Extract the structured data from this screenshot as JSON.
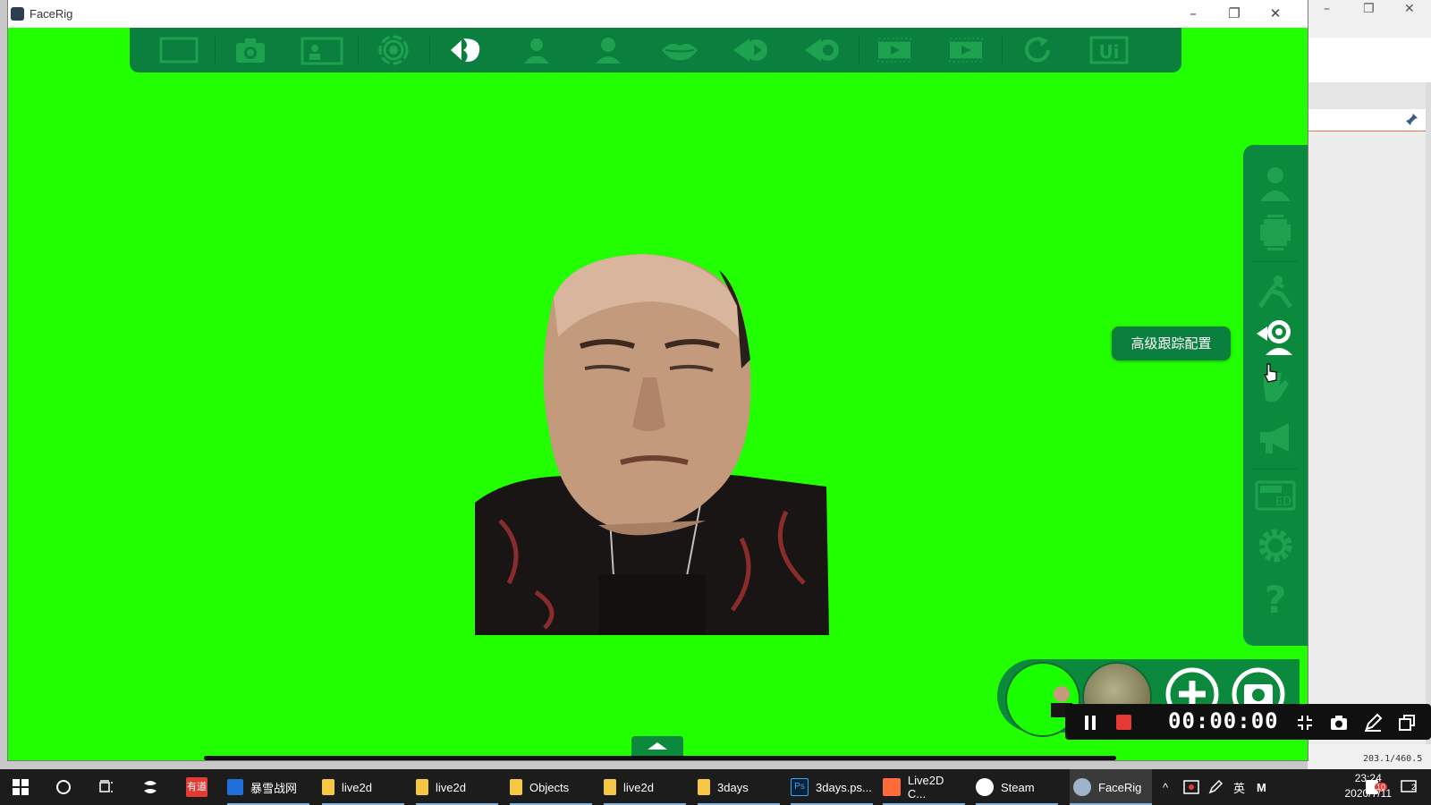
{
  "window": {
    "title": "FaceRig",
    "controls": {
      "minimize": "–",
      "restore": "❐",
      "close": "✕"
    }
  },
  "toolbar": {
    "items": [
      "fullscreen-icon",
      "camera-icon",
      "portrait-icon",
      "broadcast-icon",
      "face-tracking-icon",
      "avatar-icon",
      "avatar-alt-icon",
      "lips-icon",
      "play-icon",
      "eye-icon",
      "film-icon",
      "filmstrip-icon",
      "refresh-icon",
      "ui-icon"
    ],
    "ui_label": "Ui"
  },
  "side_panel": {
    "items": [
      "user-icon",
      "sizer-icon",
      "pose-icon",
      "advanced-tracking-icon",
      "hand-icon",
      "megaphone-icon",
      "ed-icon",
      "gear-icon",
      "help-icon"
    ],
    "ed_label": "ED",
    "help_label": "?"
  },
  "tooltip": {
    "text": "高级跟踪配置"
  },
  "recording": {
    "timer": "00:00:00"
  },
  "background_app": {
    "status": "203.1/460.5"
  },
  "taskbar": {
    "items": [
      {
        "label": "",
        "icon": "windows-icon"
      },
      {
        "label": "",
        "icon": "search-icon"
      },
      {
        "label": "",
        "icon": "task-view-icon"
      },
      {
        "label": "",
        "icon": "app-icon"
      },
      {
        "label": "有道",
        "icon": "youdao-icon"
      },
      {
        "label": "暴雪战网",
        "icon": "battlenet-icon"
      },
      {
        "label": "live2d",
        "icon": "folder-icon"
      },
      {
        "label": "live2d",
        "icon": "folder-icon"
      },
      {
        "label": "Objects",
        "icon": "folder-icon"
      },
      {
        "label": "live2d",
        "icon": "folder-icon"
      },
      {
        "label": "3days",
        "icon": "folder-icon"
      },
      {
        "label": "3days.ps...",
        "icon": "photoshop-icon"
      },
      {
        "label": "Live2D C...",
        "icon": "live2d-cubism-icon"
      },
      {
        "label": "Steam",
        "icon": "steam-icon"
      },
      {
        "label": "FaceRig",
        "icon": "facerig-icon"
      }
    ],
    "tray": {
      "ime": "英",
      "m": "M",
      "badge": "10",
      "notif": "2"
    },
    "clock": {
      "time": "23:24",
      "date": "2020/7/11"
    }
  },
  "colors": {
    "chroma": "#21ff00",
    "panel": "#0b8a3e",
    "toolbar": "#0b7f3d"
  }
}
